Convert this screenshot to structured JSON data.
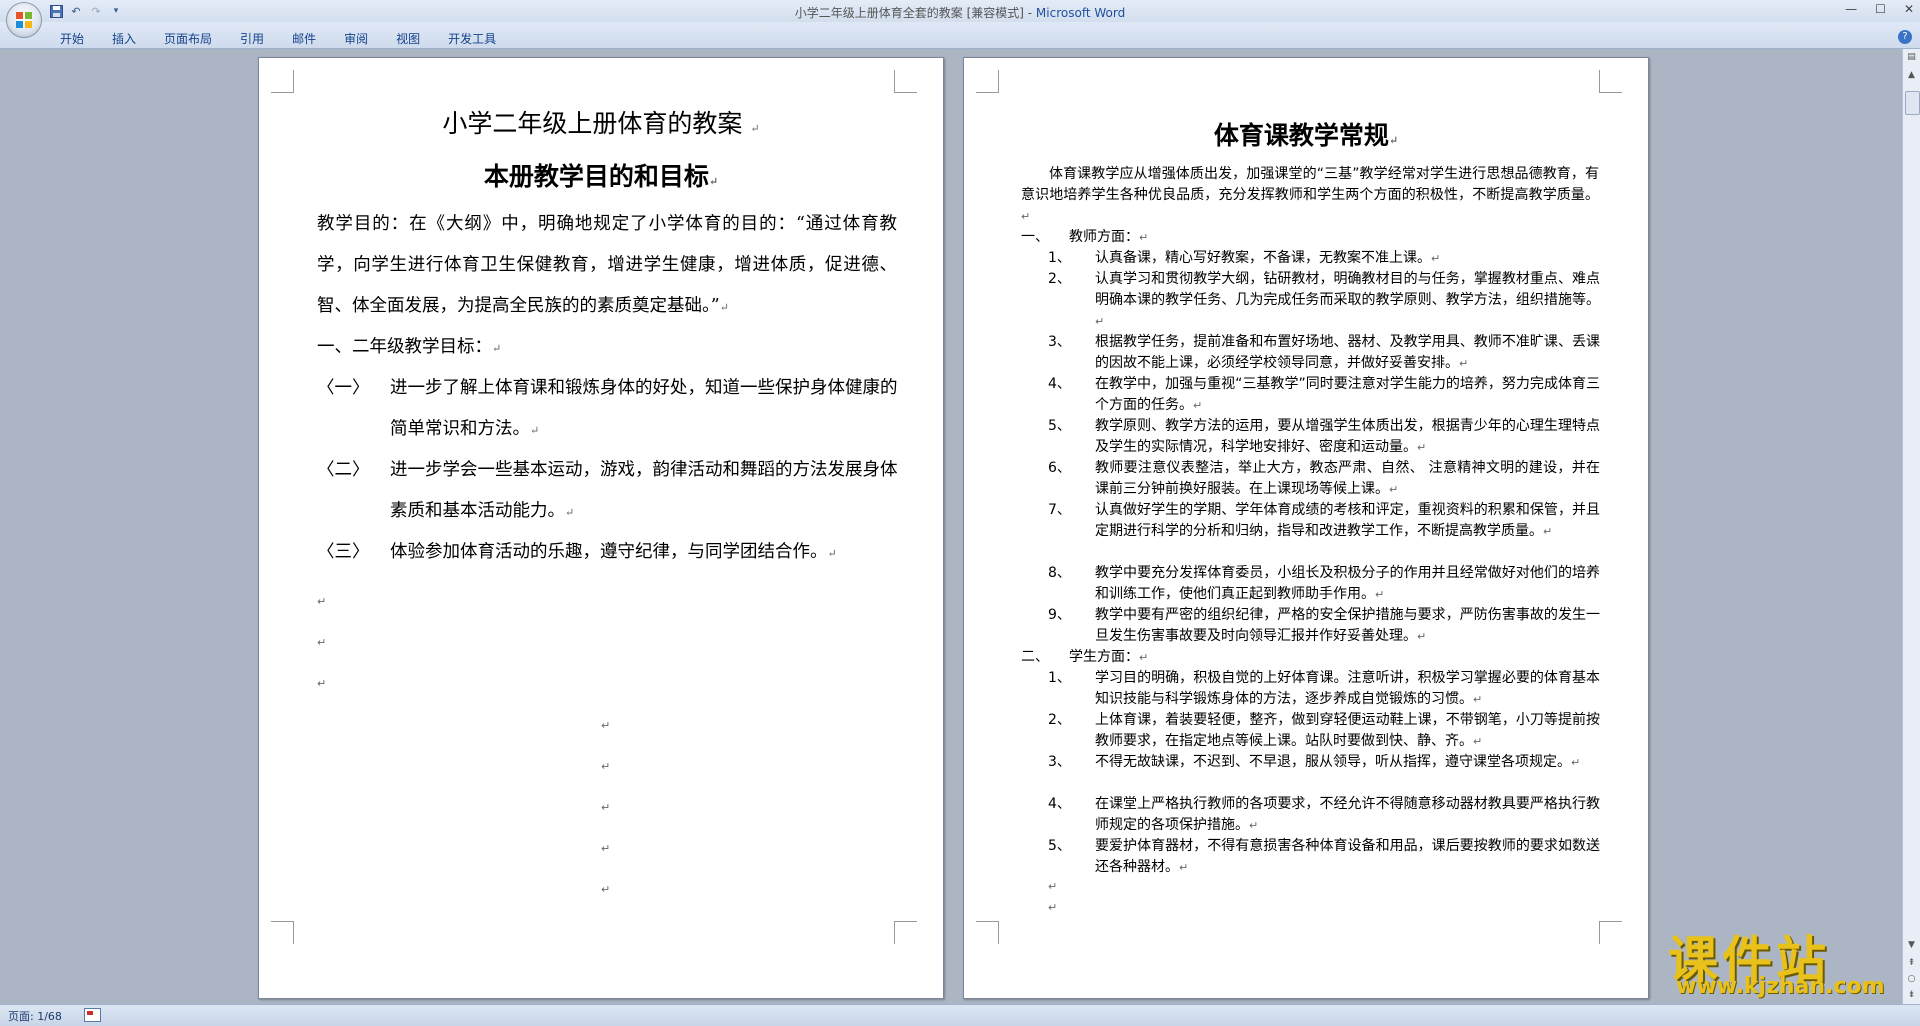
{
  "window": {
    "title": "小学二年级上册体育全套的教案 [兼容模式] - ",
    "app_name": "Microsoft Word",
    "controls": [
      "—",
      "☐",
      "✕"
    ]
  },
  "quick_access": {
    "save_icon": "save-icon",
    "undo_icon": "undo-icon",
    "redo_icon": "redo-icon",
    "customize": "▾"
  },
  "ribbon_tabs": [
    "开始",
    "插入",
    "页面布局",
    "引用",
    "邮件",
    "审阅",
    "视图",
    "开发工具"
  ],
  "help": "?",
  "left_page": {
    "title1": "小学二年级上册体育的教案",
    "title2": "本册教学目的和目标",
    "para1": "教学目的：在《大纲》中，明确地规定了小学体育的目的：“通过体育教学，向学生进行体育卫生保健教育，增进学生健康，增进体质，促进德、智、体全面发展，为提高全民族的的素质奠定基础。”",
    "goals_heading": "一、二年级教学目标：",
    "goals": [
      {
        "num": "〈一〉",
        "text": "进一步了解上体育课和锻炼身体的好处，知道一些保护身体健康的简单常识和方法。"
      },
      {
        "num": "〈二〉",
        "text": "进一步学会一些基本运动，游戏，韵律活动和舞蹈的方法发展身体素质和基本活动能力。"
      },
      {
        "num": "〈三〉",
        "text": "体验参加体育活动的乐趣，遵守纪律，与同学团结合作。"
      }
    ]
  },
  "right_page": {
    "title": "体育课教学常规",
    "intro": "体育课教学应从增强体质出发，加强课堂的“三基”教学经常对学生进行思想品德教育，有意识地培养学生各种优良品质，充分发挥教师和学生两个方面的积极性，不断提高教学质量。",
    "section1": {
      "num": "一、",
      "title": "教师方面："
    },
    "teacher_items": [
      {
        "num": "1、",
        "text": "认真备课，精心写好教案，不备课，无教案不准上课。"
      },
      {
        "num": "2、",
        "text": "认真学习和贯彻教学大纲，钻研教材，明确教材目的与任务，掌握教材重点、难点明确本课的教学任务、几为完成任务而采取的教学原则、教学方法，组织措施等。"
      },
      {
        "num": "3、",
        "text": "根据教学任务，提前准备和布置好场地、器材、及教学用具、教师不准旷课、丢课的因故不能上课，必须经学校领导同意，并做好妥善安排。"
      },
      {
        "num": "4、",
        "text": "在教学中，加强与重视“三基教学”同时要注意对学生能力的培养，努力完成体育三个方面的任务。"
      },
      {
        "num": "5、",
        "text": "教学原则、教学方法的运用，要从增强学生体质出发，根据青少年的心理生理特点及学生的实际情况，科学地安排好、密度和运动量。"
      },
      {
        "num": "6、",
        "text": "教师要注意仪表整洁，举止大方，教态严肃、自然、 注意精神文明的建设，并在课前三分钟前换好服装。在上课现场等候上课。"
      },
      {
        "num": "7、",
        "text": "认真做好学生的学期、学年体育成绩的考核和评定，重视资料的积累和保管，并且定期进行科学的分析和归纳，指导和改进教学工作，不断提高教学质量。"
      },
      {
        "num": "8、",
        "text": "教学中要充分发挥体育委员，小组长及积极分子的作用并且经常做好对他们的培养和训练工作，使他们真正起到教师助手作用。"
      },
      {
        "num": "9、",
        "text": "教学中要有严密的组织纪律，严格的安全保护措施与要求，严防伤害事故的发生一旦发生伤害事故要及时向领导汇报并作好妥善处理。"
      }
    ],
    "section2": {
      "num": "二、",
      "title": "学生方面："
    },
    "student_items": [
      {
        "num": "1、",
        "text": "学习目的明确，积极自觉的上好体育课。注意听讲，积极学习掌握必要的体育基本知识技能与科学锻炼身体的方法，逐步养成自觉锻炼的习惯。"
      },
      {
        "num": "2、",
        "text": "上体育课，着装要轻便，整齐，做到穿轻便运动鞋上课，不带钢笔，小刀等提前按教师要求，在指定地点等候上课。站队时要做到快、静、齐。"
      },
      {
        "num": "3、",
        "text": "不得无故缺课，不迟到、不早退，服从领导，听从指挥，遵守课堂各项规定。"
      },
      {
        "num": "4、",
        "text": "在课堂上严格执行教师的各项要求，不经允许不得随意移动器材教具要严格执行教师规定的各项保护措施。"
      },
      {
        "num": "5、",
        "text": "要爱护体育器材，不得有意损害各种体育设备和用品，课后要按教师的要求如数送还各种器材。"
      }
    ]
  },
  "paragraph_mark": "↵",
  "status": {
    "page": "页面: 1/68"
  },
  "watermark": {
    "brand": "课件站",
    "url": "www.kjzhan.com"
  }
}
